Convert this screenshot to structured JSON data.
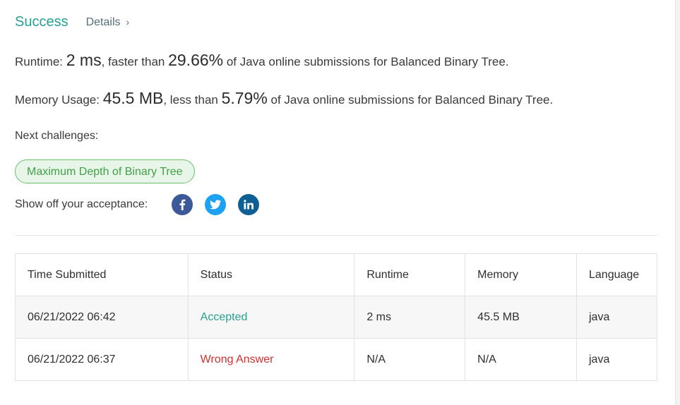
{
  "result": {
    "status": "Success",
    "details_label": "Details",
    "details_chevron": "›"
  },
  "runtime": {
    "label": "Runtime: ",
    "value": "2 ms",
    "mid": ", faster than ",
    "percent": "29.66%",
    "suffix": " of Java online submissions for Balanced Binary Tree."
  },
  "memory": {
    "label": "Memory Usage: ",
    "value": "45.5 MB",
    "mid": ", less than ",
    "percent": "5.79%",
    "suffix": " of Java online submissions for Balanced Binary Tree."
  },
  "next": {
    "title": "Next challenges:",
    "challenges": [
      "Maximum Depth of Binary Tree"
    ]
  },
  "share": {
    "label": "Show off your acceptance:",
    "icons": [
      "facebook-icon",
      "twitter-icon",
      "linkedin-icon"
    ]
  },
  "colors": {
    "success": "#26a290",
    "wrong": "#d32f2f",
    "pill_bg": "#e8f5e9",
    "pill_border": "#6cc06c",
    "facebook": "#3b5998",
    "twitter": "#1da1f2",
    "linkedin": "#0e5f94"
  },
  "table": {
    "headers": [
      "Time Submitted",
      "Status",
      "Runtime",
      "Memory",
      "Language"
    ],
    "rows": [
      {
        "time": "06/21/2022 06:42",
        "status": "Accepted",
        "runtime": "2 ms",
        "memory": "45.5 MB",
        "language": "java"
      },
      {
        "time": "06/21/2022 06:37",
        "status": "Wrong Answer",
        "runtime": "N/A",
        "memory": "N/A",
        "language": "java"
      }
    ]
  }
}
